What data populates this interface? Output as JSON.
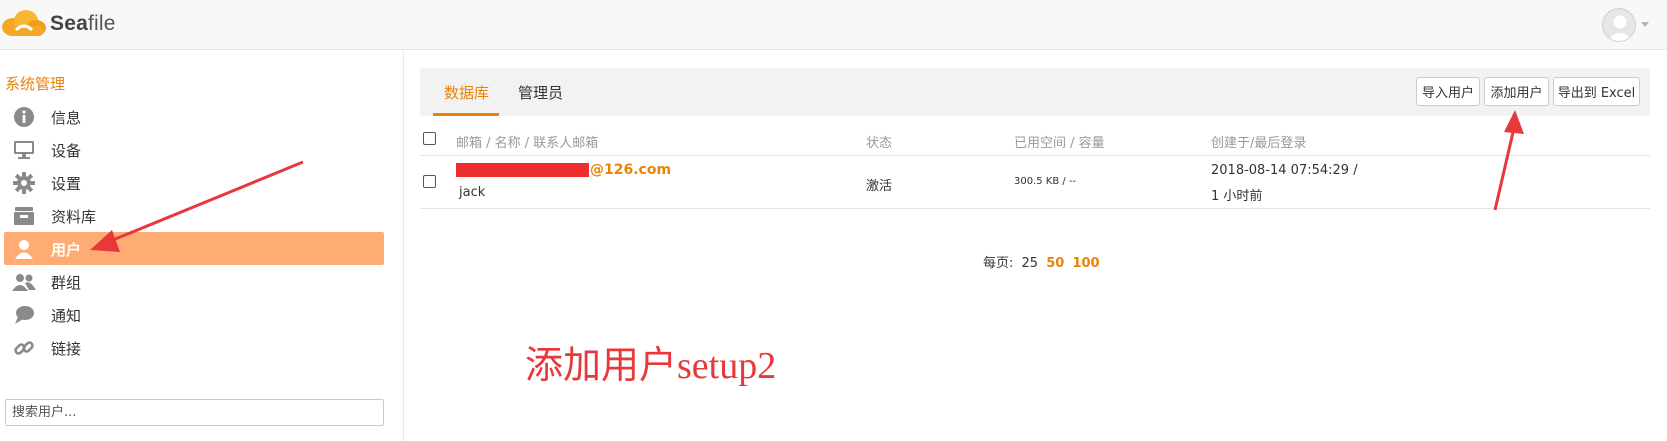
{
  "app": {
    "brand": "Seafile",
    "brand_prefix": "Sea",
    "brand_suffix": "file"
  },
  "colors": {
    "accent": "#eb8205",
    "active_nav": "#feac74",
    "annotation": "#e8383a"
  },
  "sidebar": {
    "heading": "系统管理",
    "items": [
      {
        "label": "信息",
        "icon": "info-icon",
        "active": false
      },
      {
        "label": "设备",
        "icon": "monitor-icon",
        "active": false
      },
      {
        "label": "设置",
        "icon": "gear-icon",
        "active": false
      },
      {
        "label": "资料库",
        "icon": "archive-icon",
        "active": false
      },
      {
        "label": "用户",
        "icon": "user-icon",
        "active": true
      },
      {
        "label": "群组",
        "icon": "group-icon",
        "active": false
      },
      {
        "label": "通知",
        "icon": "chat-icon",
        "active": false
      },
      {
        "label": "链接",
        "icon": "link-icon",
        "active": false
      }
    ],
    "search": {
      "placeholder": "搜索用户..."
    }
  },
  "main": {
    "tabs": [
      {
        "label": "数据库",
        "active": true
      },
      {
        "label": "管理员",
        "active": false
      }
    ],
    "buttons": {
      "import": "导入用户",
      "add": "添加用户",
      "export": "导出到 Excel"
    },
    "table": {
      "headers": {
        "email": "邮箱 / 名称 / 联系人邮箱",
        "status": "状态",
        "space": "已用空间 / 容量",
        "created": "创建于/最后登录"
      },
      "rows": [
        {
          "email_domain": "@126.com",
          "name": "jack",
          "status": "激活",
          "space": "300.5 KB / --",
          "created": "2018-08-14 07:54:29 /",
          "last_login": "1 小时前"
        }
      ]
    },
    "pagination": {
      "label": "每页:",
      "current": "25",
      "options": [
        "50",
        "100"
      ]
    }
  },
  "annotation": {
    "caption": "添加用户setup2"
  }
}
